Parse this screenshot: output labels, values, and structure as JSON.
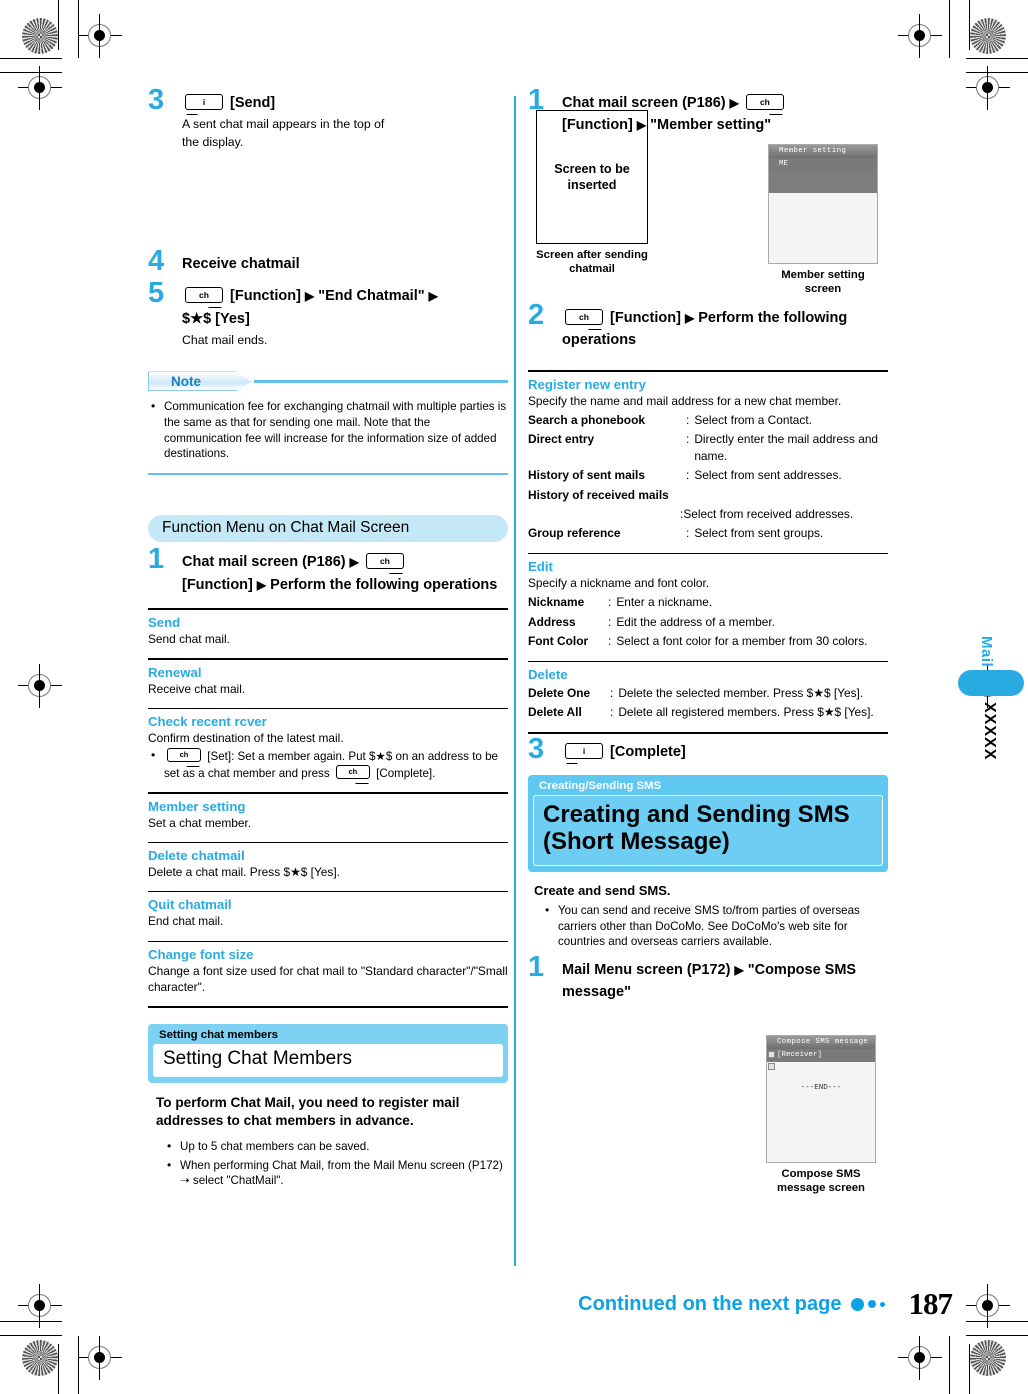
{
  "page": {
    "number": "187",
    "continued": "Continued on the next page"
  },
  "side_tab": {
    "label": "Mail",
    "code": "XXXXX"
  },
  "left_column": {
    "step3": {
      "num": "3",
      "key": "i-mode-key",
      "key_label": "[Send]",
      "body": "A sent chat mail appears in the top of the display.",
      "figure_placeholder": "Screen to be inserted",
      "figure_caption": "Screen after sending chatmail"
    },
    "step4": {
      "num": "4",
      "head": "Receive chatmail"
    },
    "step5": {
      "num": "5",
      "key": "ch-key",
      "head_part1": "[Function]",
      "head_part2": "\"End Chatmail\"",
      "head_part3": "$★$ [Yes]",
      "body": "Chat mail ends."
    },
    "note": {
      "label": "Note",
      "items": [
        "Communication fee for exchanging chatmail with multiple parties is the same as that for sending one mail. Note that the communication fee will increase for the information size of added destinations."
      ]
    },
    "function_menu": {
      "pill": "Function Menu on Chat Mail Screen",
      "step1": {
        "num": "1",
        "head_part1": "Chat mail screen (P186)",
        "key": "ch-key",
        "head_part2": "[Function]",
        "head_part3": "Perform the following operations"
      },
      "entries": [
        {
          "title": "Send",
          "desc": "Send chat mail."
        },
        {
          "title": "Renewal",
          "desc": "Receive chat mail."
        },
        {
          "title": "Check recent rcver",
          "desc": "Confirm destination of the latest mail.",
          "bullet_pre": "[Set]: Set a member again. Put $★$ on an address to be set as a chat member and press",
          "bullet_post": "[Complete].",
          "bullet_key": "ch-key"
        },
        {
          "title": "Member setting",
          "desc": "Set a chat member."
        },
        {
          "title": "Delete chatmail",
          "desc": "Delete a chat mail. Press $★$ [Yes]."
        },
        {
          "title": "Quit chatmail",
          "desc": "End chat mail."
        },
        {
          "title": "Change font size",
          "desc": "Change a font size used for chat mail to \"Standard character\"/\"Small character\"."
        }
      ]
    },
    "setting_chat_members": {
      "eyebrow": "Setting chat members",
      "title": "Setting Chat Members",
      "lead": "To perform Chat Mail, you need to register mail addresses to chat members in advance.",
      "bullets": [
        "Up to 5 chat members can be saved.",
        "When performing Chat Mail, from the Mail Menu screen (P172) ➝ select \"ChatMail\"."
      ]
    }
  },
  "right_column": {
    "step1": {
      "num": "1",
      "head_part1": "Chat mail screen (P186)",
      "key": "ch-key",
      "head_part2": "[Function]",
      "head_part3": "\"Member setting\"",
      "figure_caption": "Member setting screen",
      "figure_screen": {
        "title": "Member setting",
        "row": "ME"
      }
    },
    "step2": {
      "num": "2",
      "key": "ch-key",
      "head_part1": "[Function]",
      "head_part2": "Perform the following operations"
    },
    "register_new_entry": {
      "title": "Register new entry",
      "desc": "Specify the name and mail address for a new chat member.",
      "rows": [
        {
          "term": "Search a phonebook",
          "def": "Select from a Contact."
        },
        {
          "term": "Direct entry",
          "def": "Directly enter the mail address and name."
        },
        {
          "term": "History of sent mails",
          "def": "Select from sent addresses."
        },
        {
          "term": "History of received mails",
          "def": "Select from received addresses.",
          "wrap": true
        },
        {
          "term": "Group reference",
          "def": "Select from sent groups."
        }
      ]
    },
    "edit": {
      "title": "Edit",
      "desc": "Specify a nickname and font color.",
      "rows": [
        {
          "term": "Nickname",
          "def": "Enter a nickname."
        },
        {
          "term": "Address",
          "def": "Edit the address of a member."
        },
        {
          "term": "Font Color",
          "def": "Select a font color for a member from 30 colors."
        }
      ]
    },
    "delete": {
      "title": "Delete",
      "rows": [
        {
          "term": "Delete One",
          "def": "Delete the selected member. Press $★$ [Yes]."
        },
        {
          "term": "Delete All",
          "def": "Delete all registered members. Press $★$ [Yes]."
        }
      ]
    },
    "step3": {
      "num": "3",
      "key": "i-mode-key",
      "label": "[Complete]"
    },
    "sms_chapter": {
      "eyebrow": "Creating/Sending SMS",
      "title": "Creating and Sending SMS (Short Message)"
    },
    "sms_intro": {
      "lead": "Create and send SMS.",
      "bullets": [
        "You can send and receive SMS to/from parties of overseas carriers other than DoCoMo. See DoCoMo's web site for countries and overseas carriers available."
      ]
    },
    "sms_step1": {
      "num": "1",
      "head_part1": "Mail Menu screen (P172)",
      "head_part2": "\"Compose SMS message\"",
      "figure_caption": "Compose SMS message screen",
      "figure_screen": {
        "title": "Compose SMS message",
        "receiver": "[Receiver]",
        "end": "---END---"
      }
    }
  },
  "colors": {
    "accent": "#29abe2",
    "pill": "#c5e8f7",
    "chapter": "#5ec8f0",
    "rule": "#000000"
  }
}
